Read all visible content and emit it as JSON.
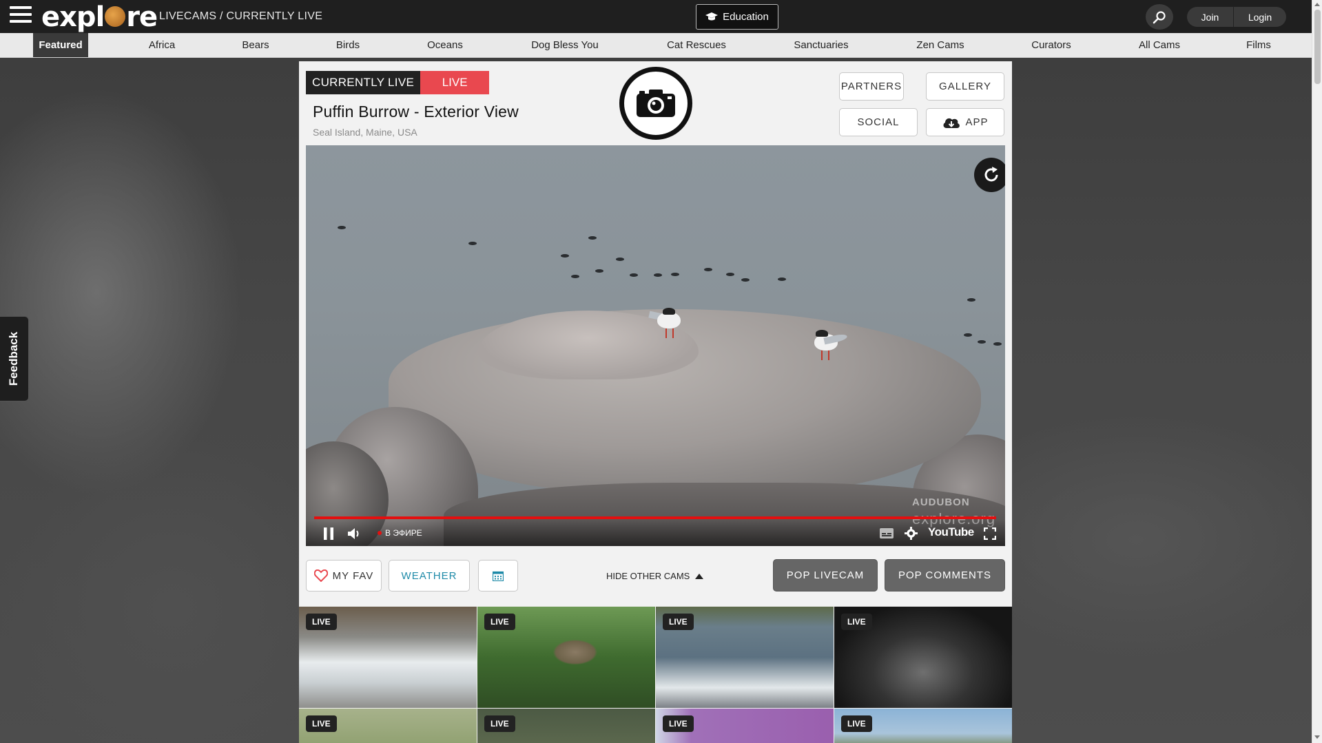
{
  "header": {
    "logo": "explore",
    "breadcrumb": "LIVECAMS / CURRENTLY LIVE",
    "education_label": "Education",
    "join_label": "Join",
    "login_label": "Login"
  },
  "nav": {
    "items": [
      "Featured",
      "Africa",
      "Bears",
      "Birds",
      "Oceans",
      "Dog Bless You",
      "Cat Rescues",
      "Sanctuaries",
      "Zen Cams",
      "Curators",
      "All Cams",
      "Films"
    ],
    "active": "Featured"
  },
  "feedback_label": "Feedback",
  "cam": {
    "currently_live_label": "CURRENTLY LIVE",
    "live_label": "LIVE",
    "title": "Puffin Burrow - Exterior View",
    "location": "Seal Island, Maine, USA",
    "partners_label": "PARTNERS",
    "gallery_label": "GALLERY",
    "social_label": "SOCIAL",
    "app_label": "APP"
  },
  "player": {
    "live_indicator": "В ЭФИРЕ",
    "youtube_label": "YouTube",
    "watermark_partner": "AUDUBON",
    "watermark_site": "explore.org",
    "progress_fraction": 1.0
  },
  "actions": {
    "my_fav_label": "MY FAV",
    "weather_label": "WEATHER",
    "hide_other_cams_label": "HIDE OTHER CAMS",
    "pop_livecam_label": "POP LIVECAM",
    "pop_comments_label": "POP COMMENTS"
  },
  "thumbnails": [
    {
      "tag": "LIVE",
      "scene": "river-rapids"
    },
    {
      "tag": "LIVE",
      "scene": "forest-tree"
    },
    {
      "tag": "LIVE",
      "scene": "river-bear"
    },
    {
      "tag": "LIVE",
      "scene": "night-water"
    },
    {
      "tag": "LIVE",
      "scene": "reeds"
    },
    {
      "tag": "LIVE",
      "scene": "pine-forest"
    },
    {
      "tag": "LIVE",
      "scene": "purple-room"
    },
    {
      "tag": "LIVE",
      "scene": "sky-landscape"
    }
  ],
  "colors": {
    "live_red": "#e9484f",
    "topbar": "#1f1f1f",
    "fav_heart": "#e9484f",
    "weather_teal": "#1e8aa8"
  }
}
